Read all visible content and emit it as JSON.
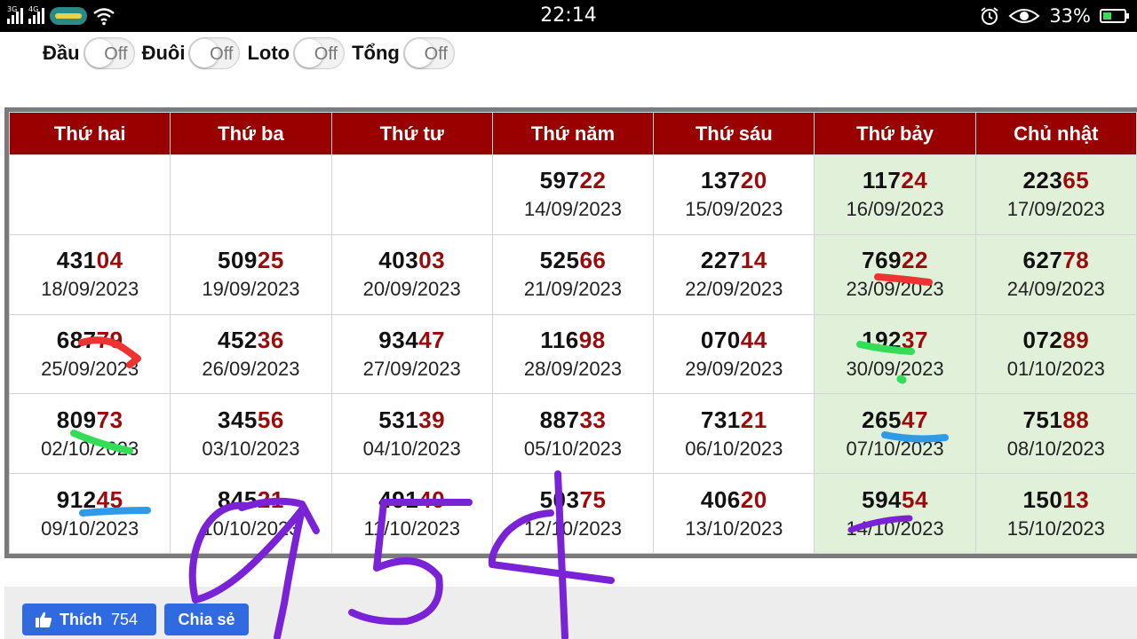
{
  "statusbar": {
    "network_1": "3G",
    "network_2": "4G",
    "time": "22:14",
    "battery_percent": "33%",
    "icons": [
      "signal-icon",
      "carrier-logo",
      "wifi-icon",
      "alarm-icon",
      "eye-comfort-icon",
      "battery-charging-icon"
    ]
  },
  "toggles": [
    {
      "label": "Đầu",
      "state": "Off"
    },
    {
      "label": "Đuôi",
      "state": "Off"
    },
    {
      "label": "Loto",
      "state": "Off"
    },
    {
      "label": "Tổng",
      "state": "Off"
    }
  ],
  "calendar": {
    "headers": [
      "Thứ hai",
      "Thứ ba",
      "Thứ tư",
      "Thứ năm",
      "Thứ sáu",
      "Thứ bảy",
      "Chủ nhật"
    ],
    "weekend_columns": [
      5,
      6
    ],
    "rows": [
      [
        null,
        null,
        null,
        {
          "head": "597",
          "tail": "22",
          "date": "14/09/2023"
        },
        {
          "head": "137",
          "tail": "20",
          "date": "15/09/2023"
        },
        {
          "head": "117",
          "tail": "24",
          "date": "16/09/2023"
        },
        {
          "head": "223",
          "tail": "65",
          "date": "17/09/2023"
        }
      ],
      [
        {
          "head": "431",
          "tail": "04",
          "date": "18/09/2023"
        },
        {
          "head": "509",
          "tail": "25",
          "date": "19/09/2023"
        },
        {
          "head": "403",
          "tail": "03",
          "date": "20/09/2023"
        },
        {
          "head": "525",
          "tail": "66",
          "date": "21/09/2023"
        },
        {
          "head": "227",
          "tail": "14",
          "date": "22/09/2023"
        },
        {
          "head": "769",
          "tail": "22",
          "date": "23/09/2023"
        },
        {
          "head": "627",
          "tail": "78",
          "date": "24/09/2023"
        }
      ],
      [
        {
          "head": "687",
          "tail": "79",
          "date": "25/09/2023"
        },
        {
          "head": "452",
          "tail": "36",
          "date": "26/09/2023"
        },
        {
          "head": "934",
          "tail": "47",
          "date": "27/09/2023"
        },
        {
          "head": "116",
          "tail": "98",
          "date": "28/09/2023"
        },
        {
          "head": "070",
          "tail": "44",
          "date": "29/09/2023"
        },
        {
          "head": "192",
          "tail": "37",
          "date": "30/09/2023"
        },
        {
          "head": "072",
          "tail": "89",
          "date": "01/10/2023"
        }
      ],
      [
        {
          "head": "809",
          "tail": "73",
          "date": "02/10/2023"
        },
        {
          "head": "345",
          "tail": "56",
          "date": "03/10/2023"
        },
        {
          "head": "531",
          "tail": "39",
          "date": "04/10/2023"
        },
        {
          "head": "887",
          "tail": "33",
          "date": "05/10/2023"
        },
        {
          "head": "731",
          "tail": "21",
          "date": "06/10/2023"
        },
        {
          "head": "265",
          "tail": "47",
          "date": "07/10/2023"
        },
        {
          "head": "751",
          "tail": "88",
          "date": "08/10/2023"
        }
      ],
      [
        {
          "head": "912",
          "tail": "45",
          "date": "09/10/2023"
        },
        {
          "head": "845",
          "tail": "21",
          "date": "10/10/2023"
        },
        {
          "head": "491",
          "tail": "40",
          "date": "11/10/2023"
        },
        {
          "head": "503",
          "tail": "75",
          "date": "12/10/2023"
        },
        {
          "head": "406",
          "tail": "20",
          "date": "13/10/2023"
        },
        {
          "head": "594",
          "tail": "54",
          "date": "14/10/2023"
        },
        {
          "head": "150",
          "tail": "13",
          "date": "15/10/2023"
        }
      ]
    ]
  },
  "footer": {
    "like_label": "Thích",
    "like_count": "754",
    "share_label": "Chia sẻ"
  },
  "colors": {
    "header_bg": "#990000",
    "tail_digits": "#9b0b0b",
    "weekend_bg": "#e0f0d9",
    "facebook_blue": "#2f6ae0",
    "marker_red": "#ee3333",
    "marker_green": "#33dd55",
    "marker_blue": "#2f9be8",
    "marker_purple": "#7a22d6"
  },
  "handwriting": {
    "drawn_digits": [
      "9",
      "5",
      "4"
    ]
  }
}
